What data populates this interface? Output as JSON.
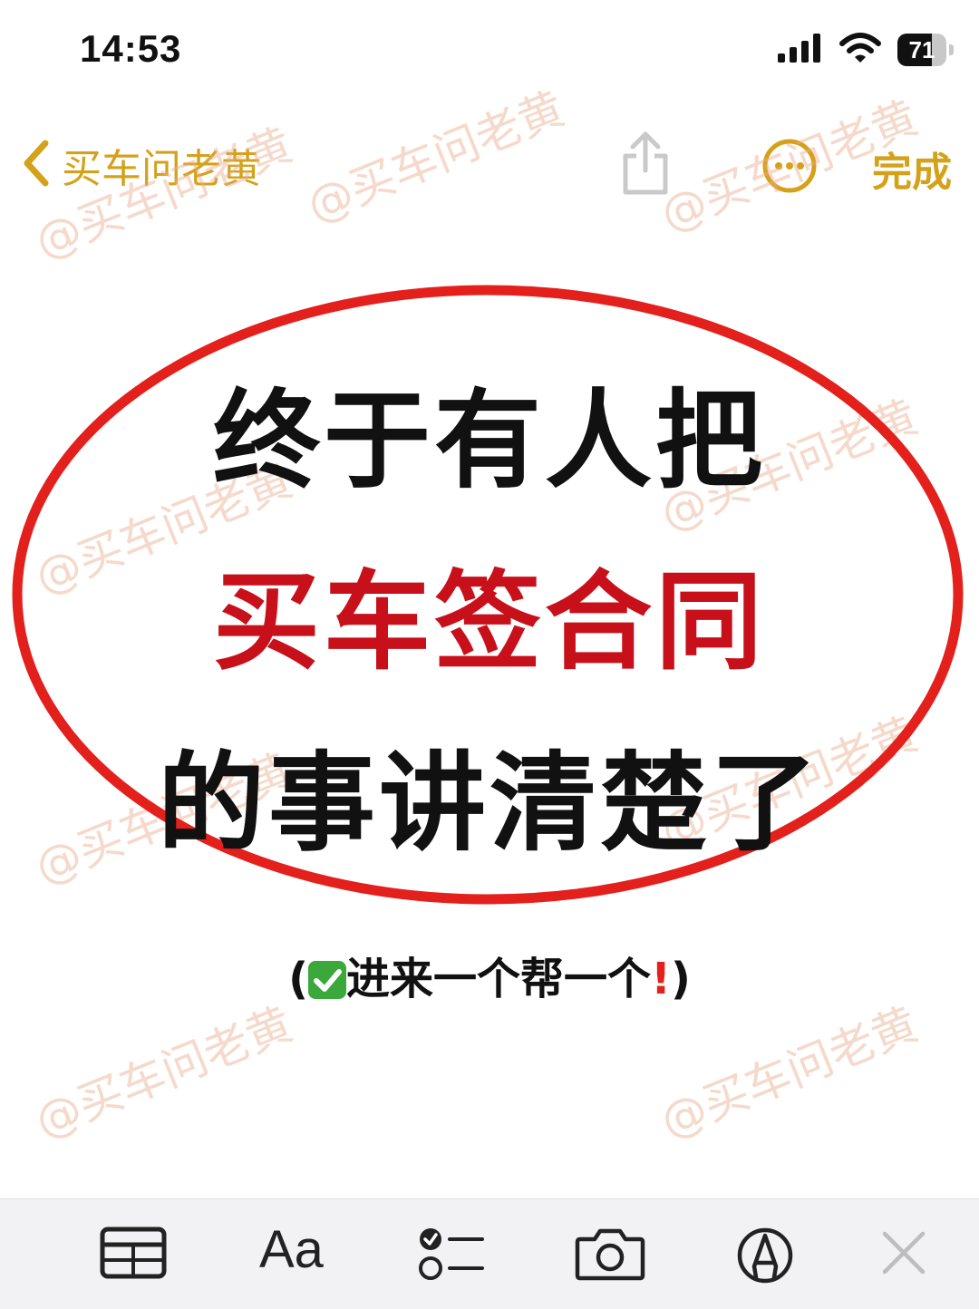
{
  "status_bar": {
    "time": "14:53",
    "battery": "71",
    "battery_level_percent": 71,
    "icons": [
      "cellular-signal-icon",
      "wifi-icon",
      "battery-icon"
    ]
  },
  "nav": {
    "back_label": "买车问老黄",
    "done_label": "完成",
    "icons": [
      "chevron-left-icon",
      "share-icon",
      "more-icon"
    ]
  },
  "watermark": {
    "text": "@买车问老黄"
  },
  "note": {
    "line1": "终于有人把",
    "line2": "买车签合同",
    "line3": "的事讲清楚了",
    "subline_open": "(",
    "subline_text": "进来一个帮一个",
    "subline_close": ")"
  },
  "toolbar": {
    "format_label": "Aa",
    "icons": [
      "table-icon",
      "format-text-icon",
      "checklist-icon",
      "camera-icon",
      "markup-icon",
      "close-icon"
    ]
  },
  "colors": {
    "accent": "#d4a21a",
    "ellipse": "#e3201b",
    "headline_red": "#c8101b",
    "toolbar_bg": "#f2f2f4"
  }
}
